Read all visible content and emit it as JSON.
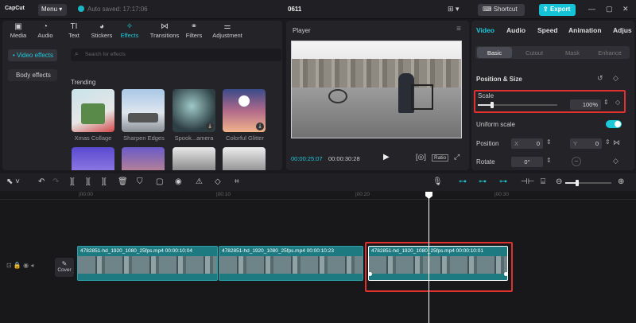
{
  "topbar": {
    "logo": "CapCut",
    "menu": "Menu",
    "autosaved": "Auto saved: 17:17:06",
    "project": "0611",
    "shortcut": "Shortcut",
    "export": "Export"
  },
  "tools": [
    {
      "label": "Media",
      "icon": "media-icon"
    },
    {
      "label": "Audio",
      "icon": "audio-icon"
    },
    {
      "label": "Text",
      "icon": "text-icon"
    },
    {
      "label": "Stickers",
      "icon": "sticker-icon"
    },
    {
      "label": "Effects",
      "icon": "effects-icon"
    },
    {
      "label": "Transitions",
      "icon": "transitions-icon"
    },
    {
      "label": "Filters",
      "icon": "filters-icon"
    },
    {
      "label": "Adjustment",
      "icon": "adjustment-icon"
    }
  ],
  "sidebar": {
    "items": [
      {
        "label": "• Video effects"
      },
      {
        "label": "Body effects"
      }
    ]
  },
  "search": {
    "placeholder": "Search for effects"
  },
  "trending": "Trending",
  "effects": [
    {
      "label": "Xmas Collage"
    },
    {
      "label": "Sharpen Edges"
    },
    {
      "label": "Spook...amera"
    },
    {
      "label": "Colorful Glitter"
    }
  ],
  "player": {
    "title": "Player",
    "current_time": "00:00:25:07",
    "total_time": "00:00:30:28",
    "ratio": "Ratio"
  },
  "inspector": {
    "tabs": [
      "Video",
      "Audio",
      "Speed",
      "Animation",
      "Adjus"
    ],
    "subtabs": [
      "Basic",
      "Cutout",
      "Mask",
      "Enhance"
    ],
    "section": "Position & Size",
    "scale_label": "Scale",
    "scale_value": "100%",
    "scale_fraction": 0.18,
    "uniform_scale": "Uniform scale",
    "position": "Position",
    "x_label": "X",
    "x_value": "0",
    "y_label": "Y",
    "y_value": "0",
    "rotate": "Rotate",
    "rotate_value": "0°"
  },
  "timeline": {
    "ruler": [
      "|00:00",
      "|00:10",
      "|00:20",
      "|00:30"
    ],
    "cover": "Cover",
    "clips": [
      {
        "label": "4782851-hd_1920_1080_25fps.mp4  00:00:10:04"
      },
      {
        "label": "4782851-hd_1920_1080_25fps.mp4  00:00:10:23"
      },
      {
        "label": "4782851-hd_1920_1080_25fps.mp4  00:00:10:01"
      }
    ]
  },
  "colors": {
    "accent": "#1ec8d8",
    "highlight": "#e03030"
  }
}
